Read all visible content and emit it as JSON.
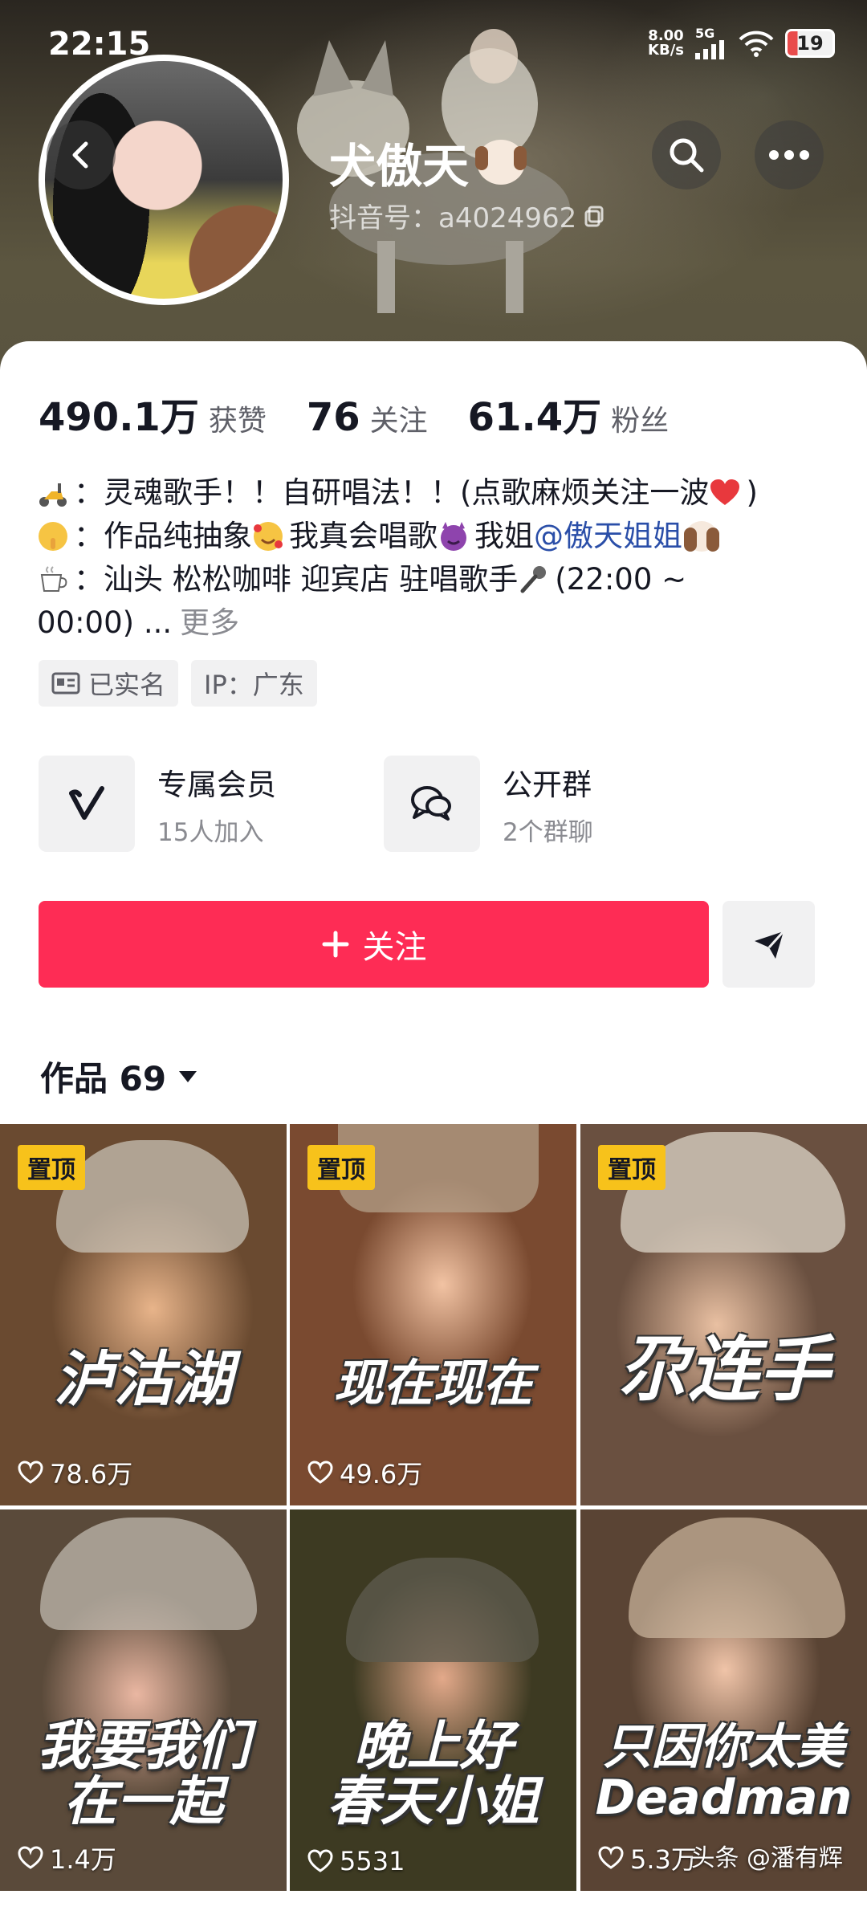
{
  "status_bar": {
    "time": "22:15",
    "net_speed": "8.00",
    "net_unit": "KB/s",
    "network": "5G",
    "battery": "19"
  },
  "profile": {
    "name": "犬傲天",
    "douyin_id": "抖音号：a4024962"
  },
  "stats": [
    {
      "value": "490.1万",
      "label": "获赞"
    },
    {
      "value": "76",
      "label": "关注"
    },
    {
      "value": "61.4万",
      "label": "粉丝"
    }
  ],
  "bio": {
    "line1": "：灵魂歌手！！自研唱法！！(点歌麻烦关注一波",
    "line1_end": ")",
    "line2_a": "：作品纯抽象",
    "line2_b": "我真会唱歌",
    "line2_c": "我姐",
    "line2_mention": "@傲天姐姐",
    "line3": "：汕头 松松咖啡 迎宾店 驻唱歌手",
    "line3_end": "(22:00 ~",
    "line4": "00:00) ...",
    "more": "更多"
  },
  "tags": [
    {
      "label": "已实名",
      "icon": "id-card-icon"
    },
    {
      "label": "IP：广东"
    }
  ],
  "features": [
    {
      "title": "专属会员",
      "subtitle": "15人加入",
      "icon": "v-logo-icon"
    },
    {
      "title": "公开群",
      "subtitle": "2个群聊",
      "icon": "chat-bubbles-icon"
    }
  ],
  "actions": {
    "follow_label": "关注",
    "share_icon": "send-icon"
  },
  "works_tab": {
    "label": "作品 69"
  },
  "videos": [
    {
      "title": "泸沽湖",
      "likes": "78.6万",
      "pinned": "置顶"
    },
    {
      "title": "现在现在",
      "likes": "49.6万",
      "pinned": "置顶"
    },
    {
      "title": "尕连手",
      "likes": "",
      "pinned": "置顶"
    },
    {
      "title_line1": "我要我们",
      "title_line2": "在一起",
      "likes": "1.4万"
    },
    {
      "title_line1": "晚上好",
      "title_line2": "春天小姐",
      "likes": "5531"
    },
    {
      "title_line1": "只因你太美",
      "title_line2": "Deadman",
      "likes": "5.3万"
    }
  ],
  "watermark": "头条 @潘有辉",
  "colors": {
    "accent": "#fe2c55",
    "pin": "#f7c21b",
    "mention": "#2a4ea8"
  }
}
